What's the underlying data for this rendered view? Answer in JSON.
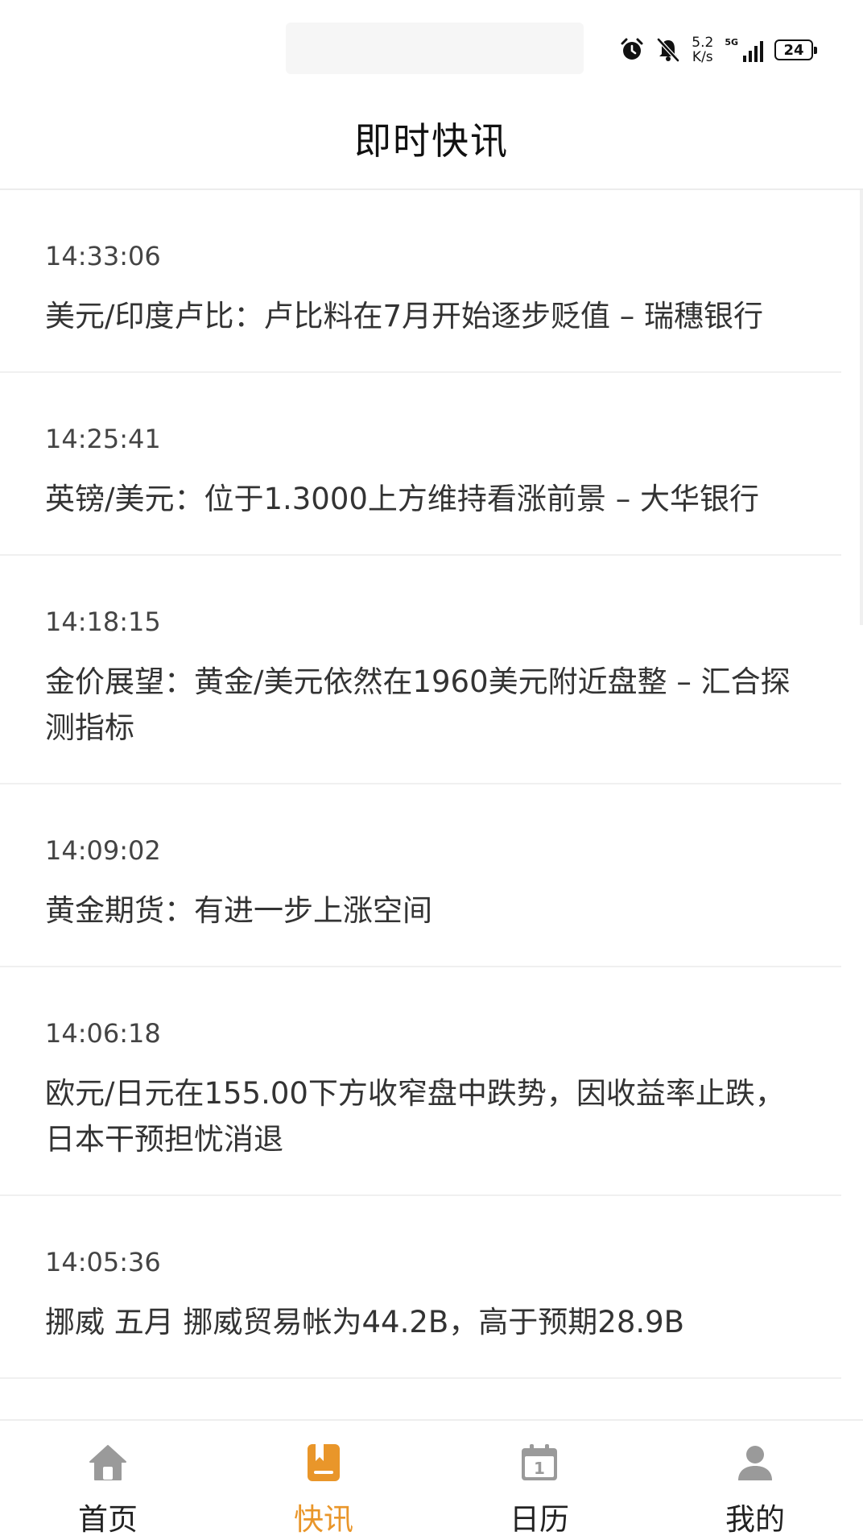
{
  "status_bar": {
    "net_speed_value": "5.2",
    "net_speed_unit": "K/s",
    "network": "5G",
    "battery": "24",
    "icons": [
      "alarm-icon",
      "mute-icon",
      "signal-icon",
      "battery-icon"
    ]
  },
  "header": {
    "title": "即时快讯"
  },
  "news": [
    {
      "time": "14:33:06",
      "text": "美元/印度卢比：卢比料在7月开始逐步贬值 – 瑞穗银行"
    },
    {
      "time": "14:25:41",
      "text": "英镑/美元：位于1.3000上方维持看涨前景 – 大华银行"
    },
    {
      "time": "14:18:15",
      "text": "金价展望：黄金/美元依然在1960美元附近盘整 – 汇合探测指标"
    },
    {
      "time": "14:09:02",
      "text": "黄金期货：有进一步上涨空间"
    },
    {
      "time": "14:06:18",
      "text": "欧元/日元在155.00下方收窄盘中跌势，因收益率止跌，日本干预担忧消退"
    },
    {
      "time": "14:05:36",
      "text": "挪威 五月 挪威贸易帐为44.2B，高于预期28.9B"
    }
  ],
  "tabs": [
    {
      "label": "首页",
      "icon": "home-icon",
      "active": false
    },
    {
      "label": "快讯",
      "icon": "news-icon",
      "active": true
    },
    {
      "label": "日历",
      "icon": "calendar-icon",
      "active": false
    },
    {
      "label": "我的",
      "icon": "user-icon",
      "active": false
    }
  ],
  "colors": {
    "accent": "#e9962a",
    "tab_icon_inactive": "#9a9a9a",
    "divider": "#f0f0f0"
  }
}
